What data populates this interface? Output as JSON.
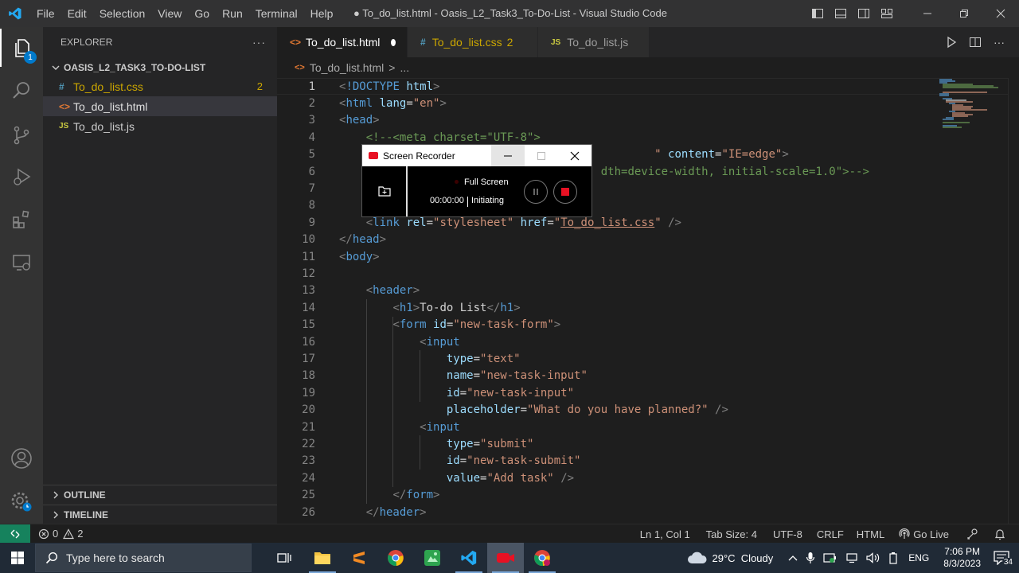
{
  "titlebar": {
    "menu": [
      "File",
      "Edit",
      "Selection",
      "View",
      "Go",
      "Run",
      "Terminal",
      "Help"
    ],
    "title": "● To_do_list.html - Oasis_L2_Task3_To-Do-List - Visual Studio Code"
  },
  "activitybar": {
    "explorer_badge": "1"
  },
  "sidebar": {
    "header": "EXPLORER",
    "more": "···",
    "folder": "OASIS_L2_TASK3_TO-DO-LIST",
    "files": [
      {
        "icon": "#",
        "name": "To_do_list.css",
        "badge": "2"
      },
      {
        "icon": "<>",
        "name": "To_do_list.html",
        "badge": ""
      },
      {
        "icon": "JS",
        "name": "To_do_list.js",
        "badge": ""
      }
    ],
    "outline": "OUTLINE",
    "timeline": "TIMELINE"
  },
  "tabs": [
    {
      "icon": "<>",
      "label": "To_do_list.html"
    },
    {
      "icon": "#",
      "label": "To_do_list.css",
      "badge": "2"
    },
    {
      "icon": "JS",
      "label": "To_do_list.js"
    }
  ],
  "breadcrumb": {
    "file": "To_do_list.html",
    "sep": ">",
    "more": "..."
  },
  "editor": {
    "line_numbers": [
      "1",
      "2",
      "3",
      "4",
      "5",
      "6",
      "7",
      "8",
      "9",
      "10",
      "11",
      "12",
      "13",
      "14",
      "15",
      "16",
      "17",
      "18",
      "19",
      "20",
      "21",
      "22",
      "23",
      "24",
      "25",
      "26"
    ],
    "lines": [
      [
        {
          "c": "t-punct",
          "t": "<"
        },
        {
          "c": "t-tag",
          "t": "!DOCTYPE"
        },
        {
          "c": "t-text",
          "t": " "
        },
        {
          "c": "t-attr",
          "t": "html"
        },
        {
          "c": "t-punct",
          "t": ">"
        }
      ],
      [
        {
          "c": "t-punct",
          "t": "<"
        },
        {
          "c": "t-tag",
          "t": "html"
        },
        {
          "c": "t-text",
          "t": " "
        },
        {
          "c": "t-attr",
          "t": "lang"
        },
        {
          "c": "t-text",
          "t": "="
        },
        {
          "c": "t-str",
          "t": "\"en\""
        },
        {
          "c": "t-punct",
          "t": ">"
        }
      ],
      [
        {
          "c": "t-punct",
          "t": "<"
        },
        {
          "c": "t-tag",
          "t": "head"
        },
        {
          "c": "t-punct",
          "t": ">"
        }
      ],
      [
        {
          "c": "t-text",
          "t": "    "
        },
        {
          "c": "t-cmt",
          "t": "<!--<meta charset=\"UTF-8\">"
        }
      ],
      [
        {
          "c": "t-text",
          "t": "                                               "
        },
        {
          "c": "t-str",
          "t": "\""
        },
        {
          "c": "t-text",
          "t": " "
        },
        {
          "c": "t-attr",
          "t": "content"
        },
        {
          "c": "t-text",
          "t": "="
        },
        {
          "c": "t-str",
          "t": "\"IE=edge\""
        },
        {
          "c": "t-punct",
          "t": ">"
        }
      ],
      [
        {
          "c": "t-text",
          "t": "                                       "
        },
        {
          "c": "t-cmt",
          "t": "dth=device-width, initial-scale=1.0\">-->"
        }
      ],
      [
        {
          "c": "t-text",
          "t": ""
        }
      ],
      [
        {
          "c": "t-text",
          "t": ""
        }
      ],
      [
        {
          "c": "t-text",
          "t": "    "
        },
        {
          "c": "t-punct",
          "t": "<"
        },
        {
          "c": "t-tag",
          "t": "link"
        },
        {
          "c": "t-text",
          "t": " "
        },
        {
          "c": "t-attr",
          "t": "rel"
        },
        {
          "c": "t-text",
          "t": "="
        },
        {
          "c": "t-str",
          "t": "\"stylesheet\""
        },
        {
          "c": "t-text",
          "t": " "
        },
        {
          "c": "t-attr",
          "t": "href"
        },
        {
          "c": "t-text",
          "t": "="
        },
        {
          "c": "t-str",
          "t": "\""
        },
        {
          "c": "t-link",
          "t": "To_do_list.css"
        },
        {
          "c": "t-str",
          "t": "\""
        },
        {
          "c": "t-text",
          "t": " "
        },
        {
          "c": "t-punct",
          "t": "/>"
        }
      ],
      [
        {
          "c": "t-punct",
          "t": "</"
        },
        {
          "c": "t-tag",
          "t": "head"
        },
        {
          "c": "t-punct",
          "t": ">"
        }
      ],
      [
        {
          "c": "t-punct",
          "t": "<"
        },
        {
          "c": "t-tag",
          "t": "body"
        },
        {
          "c": "t-punct",
          "t": ">"
        }
      ],
      [
        {
          "c": "t-text",
          "t": ""
        }
      ],
      [
        {
          "c": "t-text",
          "t": "    "
        },
        {
          "c": "t-punct",
          "t": "<"
        },
        {
          "c": "t-tag",
          "t": "header"
        },
        {
          "c": "t-punct",
          "t": ">"
        }
      ],
      [
        {
          "c": "t-text",
          "t": "        "
        },
        {
          "c": "t-punct",
          "t": "<"
        },
        {
          "c": "t-tag",
          "t": "h1"
        },
        {
          "c": "t-punct",
          "t": ">"
        },
        {
          "c": "t-text",
          "t": "To-do List"
        },
        {
          "c": "t-punct",
          "t": "</"
        },
        {
          "c": "t-tag",
          "t": "h1"
        },
        {
          "c": "t-punct",
          "t": ">"
        }
      ],
      [
        {
          "c": "t-text",
          "t": "        "
        },
        {
          "c": "t-punct",
          "t": "<"
        },
        {
          "c": "t-tag",
          "t": "form"
        },
        {
          "c": "t-text",
          "t": " "
        },
        {
          "c": "t-attr",
          "t": "id"
        },
        {
          "c": "t-text",
          "t": "="
        },
        {
          "c": "t-str",
          "t": "\"new-task-form\""
        },
        {
          "c": "t-punct",
          "t": ">"
        }
      ],
      [
        {
          "c": "t-text",
          "t": "            "
        },
        {
          "c": "t-punct",
          "t": "<"
        },
        {
          "c": "t-tag",
          "t": "input"
        }
      ],
      [
        {
          "c": "t-text",
          "t": "                "
        },
        {
          "c": "t-attr",
          "t": "type"
        },
        {
          "c": "t-text",
          "t": "="
        },
        {
          "c": "t-str",
          "t": "\"text\""
        }
      ],
      [
        {
          "c": "t-text",
          "t": "                "
        },
        {
          "c": "t-attr",
          "t": "name"
        },
        {
          "c": "t-text",
          "t": "="
        },
        {
          "c": "t-str",
          "t": "\"new-task-input\""
        }
      ],
      [
        {
          "c": "t-text",
          "t": "                "
        },
        {
          "c": "t-attr",
          "t": "id"
        },
        {
          "c": "t-text",
          "t": "="
        },
        {
          "c": "t-str",
          "t": "\"new-task-input\""
        }
      ],
      [
        {
          "c": "t-text",
          "t": "                "
        },
        {
          "c": "t-attr",
          "t": "placeholder"
        },
        {
          "c": "t-text",
          "t": "="
        },
        {
          "c": "t-str",
          "t": "\"What do you have planned?\""
        },
        {
          "c": "t-text",
          "t": " "
        },
        {
          "c": "t-punct",
          "t": "/>"
        }
      ],
      [
        {
          "c": "t-text",
          "t": "            "
        },
        {
          "c": "t-punct",
          "t": "<"
        },
        {
          "c": "t-tag",
          "t": "input"
        }
      ],
      [
        {
          "c": "t-text",
          "t": "                "
        },
        {
          "c": "t-attr",
          "t": "type"
        },
        {
          "c": "t-text",
          "t": "="
        },
        {
          "c": "t-str",
          "t": "\"submit\""
        }
      ],
      [
        {
          "c": "t-text",
          "t": "                "
        },
        {
          "c": "t-attr",
          "t": "id"
        },
        {
          "c": "t-text",
          "t": "="
        },
        {
          "c": "t-str",
          "t": "\"new-task-submit\""
        }
      ],
      [
        {
          "c": "t-text",
          "t": "                "
        },
        {
          "c": "t-attr",
          "t": "value"
        },
        {
          "c": "t-text",
          "t": "="
        },
        {
          "c": "t-str",
          "t": "\"Add task\""
        },
        {
          "c": "t-text",
          "t": " "
        },
        {
          "c": "t-punct",
          "t": "/>"
        }
      ],
      [
        {
          "c": "t-text",
          "t": "        "
        },
        {
          "c": "t-punct",
          "t": "</"
        },
        {
          "c": "t-tag",
          "t": "form"
        },
        {
          "c": "t-punct",
          "t": ">"
        }
      ],
      [
        {
          "c": "t-text",
          "t": "    "
        },
        {
          "c": "t-punct",
          "t": "</"
        },
        {
          "c": "t-tag",
          "t": "header"
        },
        {
          "c": "t-punct",
          "t": ">"
        }
      ]
    ]
  },
  "recorder": {
    "title": "Screen Recorder",
    "mode": "Full Screen",
    "time": "00:00:00",
    "status": "Initiating"
  },
  "statusbar": {
    "errors": "0",
    "warnings": "2",
    "position": "Ln 1, Col 1",
    "tab_size": "Tab Size: 4",
    "encoding": "UTF-8",
    "eol": "CRLF",
    "language": "HTML",
    "go_live": "Go Live"
  },
  "taskbar": {
    "search_placeholder": "Type here to search",
    "weather": "29°C  Cloudy",
    "lang": "ENG",
    "time": "7:06 PM",
    "date": "8/3/2023",
    "notifications": "34"
  },
  "colors": {
    "accent": "#007acc",
    "remote": "#16825d",
    "warning": "#cca700",
    "record": "#e81123"
  }
}
